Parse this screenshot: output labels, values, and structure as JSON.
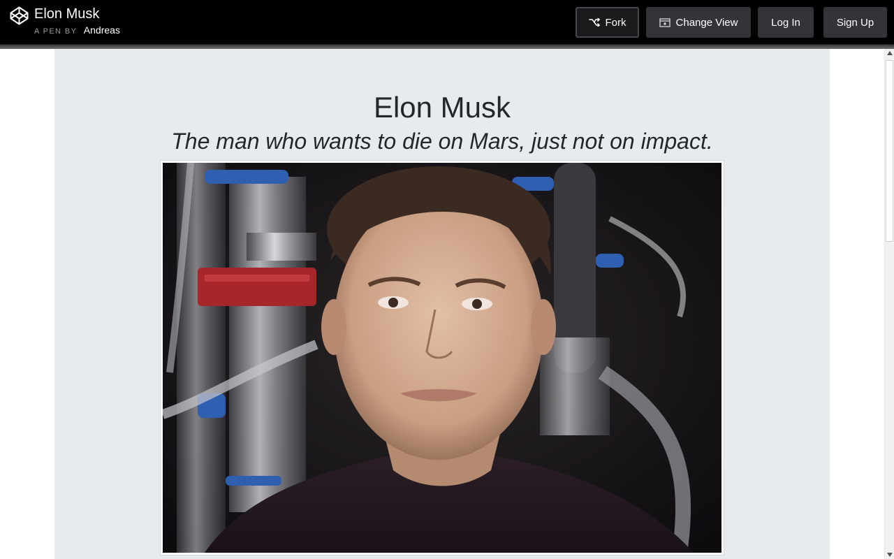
{
  "header": {
    "pen_title": "Elon Musk",
    "pen_by_label": "A PEN BY",
    "author": "Andreas",
    "buttons": {
      "fork": "Fork",
      "change_view": "Change View",
      "login": "Log In",
      "signup": "Sign Up"
    },
    "icons": {
      "logo": "codepen-logo-icon",
      "fork": "fork-icon",
      "change_view": "window-view-icon"
    }
  },
  "main": {
    "title": "Elon Musk",
    "tagline": "The man who wants to die on Mars, just not on impact.",
    "image_description": "portrait-photo"
  },
  "colors": {
    "header_bg": "#000000",
    "button_bg": "#333438",
    "content_bg": "#e7ebee",
    "text": "#23272a"
  }
}
